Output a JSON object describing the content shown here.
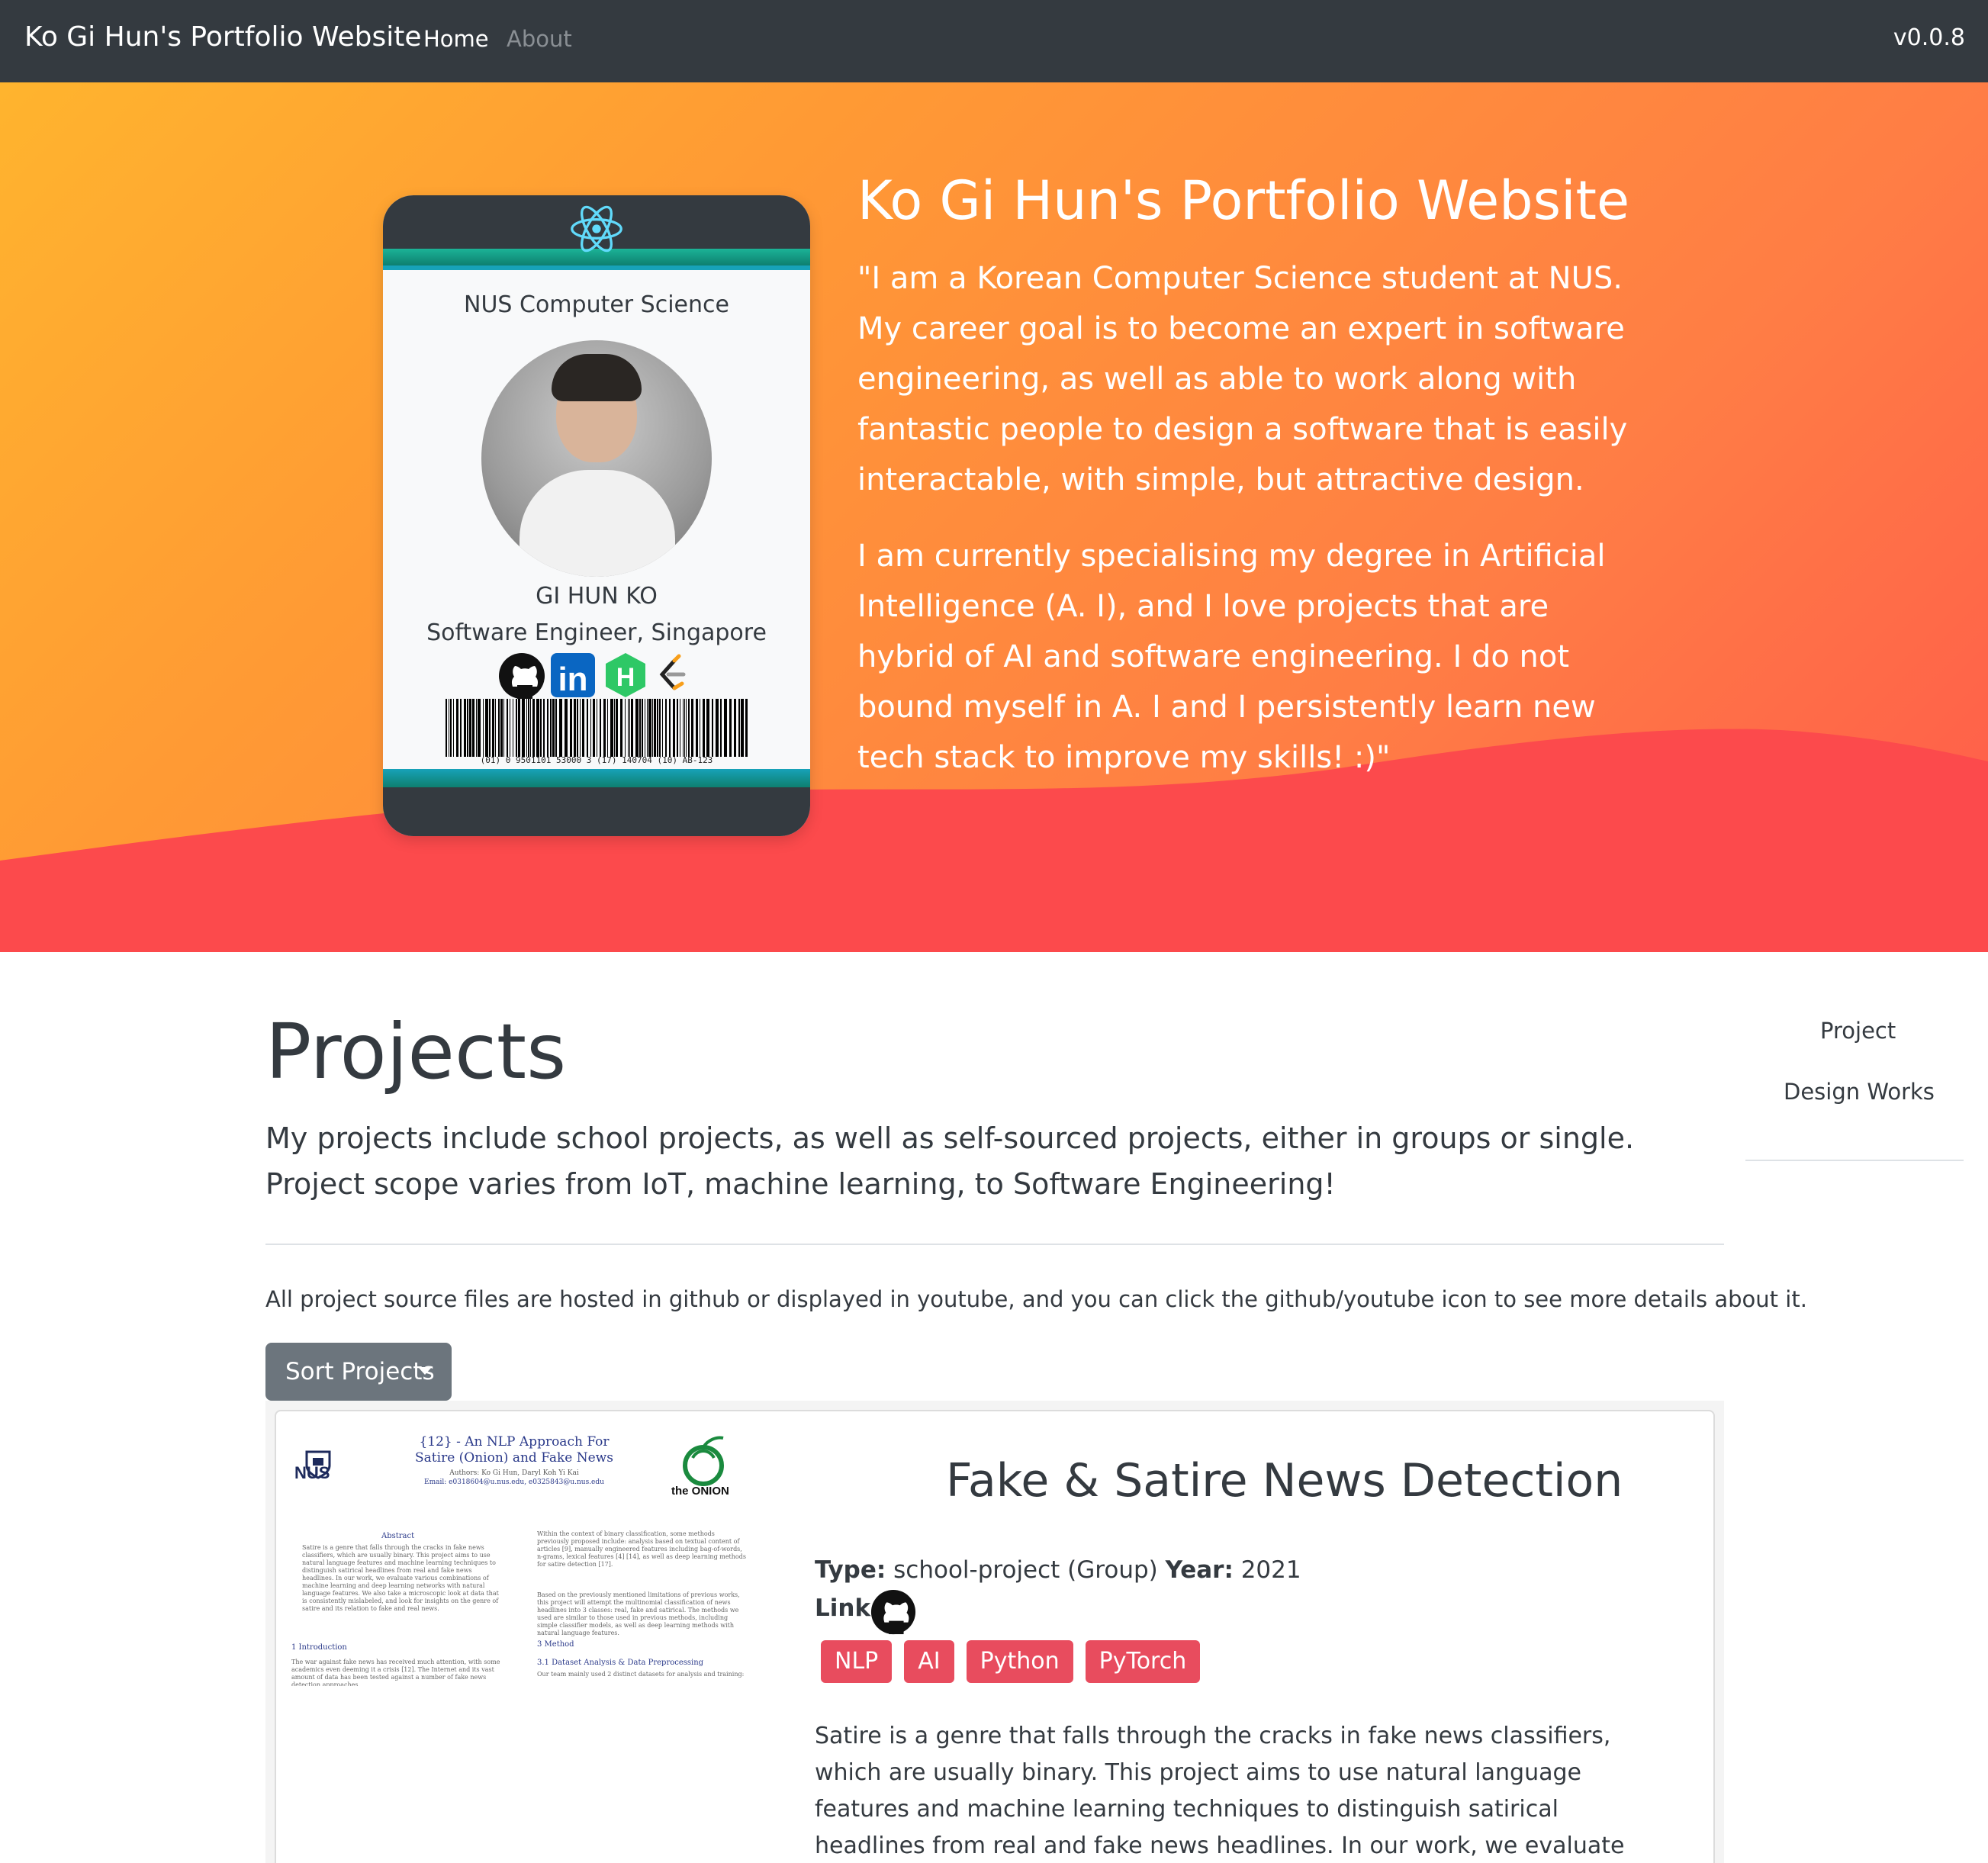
{
  "navbar": {
    "brand": "Ko Gi Hun's Portfolio Website",
    "links": [
      "Home",
      "About"
    ],
    "version": "v0.0.8"
  },
  "id_card": {
    "school": "NUS Computer Science",
    "name": "GI HUN KO",
    "role": "Software Engineer, Singapore",
    "icons": [
      "github-icon",
      "linkedin-icon",
      "hackerrank-icon",
      "leetcode-icon"
    ],
    "barcode_text": "(01) 0 9501101 53000 3 (17) 140704 (10) AB-123"
  },
  "hero": {
    "title": "Ko Gi Hun's Portfolio Website",
    "paragraph1": "\"I am a Korean Computer Science student at NUS. My career goal is to become an expert in software engineering, as well as able to work along with fantastic people to design a software that is easily interactable, with simple, but attractive design.",
    "paragraph2": "I am currently specialising my degree in Artificial Intelligence (A. I), and I love projects that are hybrid of AI and software engineering. I do not bound myself in A. I and I persistently learn new tech stack to improve my skills! :)\""
  },
  "projects": {
    "title": "Projects",
    "description": "My projects include school projects, as well as self-sourced projects, either in groups or single. Project scope varies from IoT, machine learning, to Software Engineering!",
    "note": "All project source files are hosted in github or displayed in youtube, and you can click the github/youtube icon to see more details about it.",
    "sort_label": "Sort Projects"
  },
  "side_nav": {
    "links": [
      "Project",
      "Design Works"
    ]
  },
  "project_card": {
    "poster": {
      "title": "{12} - An NLP Approach For Satire (Onion) and Fake News",
      "authors": "Authors: Ko Gi Hun, Daryl Koh Yi Kai",
      "email": "Email: e0318604@u.nus.edu, e0325843@u.nus.edu",
      "nus_label": "NUS",
      "onion_label": "the ONION",
      "abstract_heading": "Abstract",
      "intro_heading": "1 Introduction",
      "method_heading": "3 Method",
      "dataset_heading": "3.1 Dataset Analysis & Data Preprocessing",
      "abstract_text": "Satire is a genre that falls through the cracks in fake news classifiers, which are usually binary. This project aims to use natural language features and machine learning techniques to distinguish satirical headlines from real and fake news headlines. In our work, we evaluate various combinations of machine learning and deep learning networks with natural language features. We also take a microscopic look at data that is consistently mislabeled, and look for insights on the genre of satire and its relation to fake and real news.",
      "intro_text": "The war against fake news has received much attention, with some academics even deeming it a crisis [12]. The Internet and its vast amount of data has been tested against a number of fake news detection approaches.",
      "right_text": "Within the context of binary classification, some methods previously proposed include: analysis based on textual content of articles [9], manually engineered features including bag-of-words, n-grams, lexical features [4] [14], as well as deep learning methods for satire detection [17].",
      "right_text2": "Based on the previously mentioned limitations of previous works, this project will attempt the multinomial classification of news headlines into 3 classes: real, fake and satirical. The methods we used are similar to those used in previous methods, including simple classifier models, as well as deep learning methods with natural language features.",
      "dataset_text": "Our team mainly used 2 distinct datasets for analysis and training:"
    },
    "title": "Fake & Satire News Detection",
    "type_label": "Type:",
    "type_value": "school-project (Group)",
    "year_label": "Year:",
    "year_value": "2021",
    "link_label": "Link:",
    "tags": [
      "NLP",
      "AI",
      "Python",
      "PyTorch"
    ],
    "description": "Satire is a genre that falls through the cracks in fake news classifiers, which are usually binary. This project aims to use natural language features and machine learning techniques to distinguish satirical headlines from real and fake news headlines. In our work, we evaluate various combinations of machine learning and"
  },
  "colors": {
    "navbar": "#343a40",
    "hero_gradient_start": "#ffb42e",
    "hero_gradient_end": "#ff5a4b",
    "wave": "#fc4a4c",
    "tag": "#e84c5e",
    "button": "#6c757d",
    "teal_stripe": "#1bb397"
  }
}
